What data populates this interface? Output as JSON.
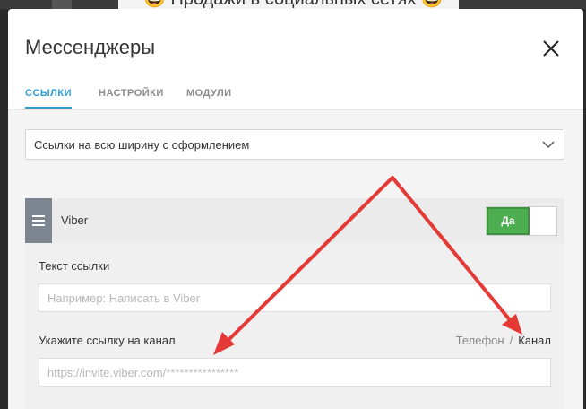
{
  "background": {
    "title": "😀 Продажи в социальных сетях 😀"
  },
  "modal": {
    "title": "Мессенджеры",
    "tabs": [
      {
        "label": "ССЫЛКИ",
        "active": true
      },
      {
        "label": "НАСТРОЙКИ",
        "active": false
      },
      {
        "label": "МОДУЛИ",
        "active": false
      }
    ],
    "layout_select": {
      "value": "Ссылки на всю ширину с оформлением"
    },
    "messenger": {
      "name": "Viber",
      "toggle_label": "Да",
      "toggle_on": true,
      "link_text": {
        "label": "Текст ссылки",
        "value": "",
        "placeholder": "Например: Написать в Viber"
      },
      "channel_link": {
        "label": "Укажите ссылку на канал",
        "value": "",
        "placeholder": "https://invite.viber.com/****************"
      },
      "mode_options": {
        "phone": "Телефон",
        "separator": "/",
        "channel": "Канал",
        "selected": "Канал"
      }
    }
  },
  "colors": {
    "accent": "#2d9cdb",
    "toggle_green": "#4cae4f",
    "annotation_arrow": "#e53935",
    "handle_gray": "#7d8590"
  },
  "icons": {
    "close": "close-icon",
    "chevron": "chevron-down-icon",
    "drag": "drag-handle-icon"
  }
}
